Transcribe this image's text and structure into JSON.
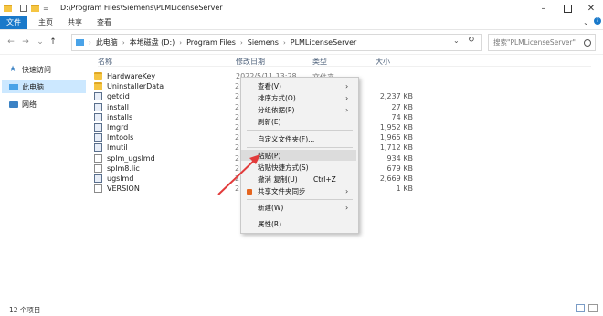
{
  "title": {
    "path": "D:\\Program Files\\Siemens\\PLMLicenseServer",
    "quick_access_divider": "="
  },
  "ribbon": {
    "tabs": [
      "文件",
      "主页",
      "共享",
      "查看"
    ]
  },
  "address": {
    "crumbs": [
      "此电脑",
      "本地磁盘 (D:)",
      "Program Files",
      "Siemens",
      "PLMLicenseServer"
    ]
  },
  "search": {
    "placeholder": "搜索\"PLMLicenseServer\""
  },
  "sidebar": {
    "items": [
      {
        "label": "快速访问"
      },
      {
        "label": "此电脑"
      },
      {
        "label": "网络"
      }
    ]
  },
  "columns": {
    "name": "名称",
    "date": "修改日期",
    "type": "类型",
    "size": "大小"
  },
  "files": [
    {
      "name": "HardwareKey",
      "icon": "folder",
      "size": ""
    },
    {
      "name": "UninstallerData",
      "icon": "folder",
      "size": ""
    },
    {
      "name": "getcid",
      "icon": "exe",
      "size": "2,237 KB"
    },
    {
      "name": "install",
      "icon": "exe",
      "size": "27 KB"
    },
    {
      "name": "installs",
      "icon": "exe",
      "size": "74 KB"
    },
    {
      "name": "lmgrd",
      "icon": "exe",
      "size": "1,952 KB"
    },
    {
      "name": "lmtools",
      "icon": "exe",
      "size": "1,965 KB"
    },
    {
      "name": "lmutil",
      "icon": "exe",
      "size": "1,712 KB"
    },
    {
      "name": "splm_ugslmd",
      "icon": "doc",
      "size": "934 KB"
    },
    {
      "name": "splm8.lic",
      "icon": "doc",
      "size": "679 KB"
    },
    {
      "name": "ugslmd",
      "icon": "exe",
      "size": "2,669 KB"
    },
    {
      "name": "VERSION",
      "icon": "doc",
      "size": "1 KB"
    }
  ],
  "date_fragments": {
    "first_row": "2022/5/11 13:28",
    "first_type": "文件夹",
    "col_digit": "2"
  },
  "context_menu": {
    "view": "查看(V)",
    "sort": "排序方式(O)",
    "group": "分组依据(P)",
    "refresh": "刷新(E)",
    "customize": "自定义文件夹(F)...",
    "paste": "粘贴(P)",
    "paste_shortcut": "粘贴快捷方式(S)",
    "undo": "撤消 复制(U)",
    "undo_shortcut": "Ctrl+Z",
    "share_sync": "共享文件夹同步",
    "new": "新建(W)",
    "properties": "属性(R)"
  },
  "status": {
    "count": "12 个项目"
  },
  "colors": {
    "file_tab": "#1979ca",
    "selected_nav": "#cce8ff",
    "arrow": "#e23b3b"
  }
}
